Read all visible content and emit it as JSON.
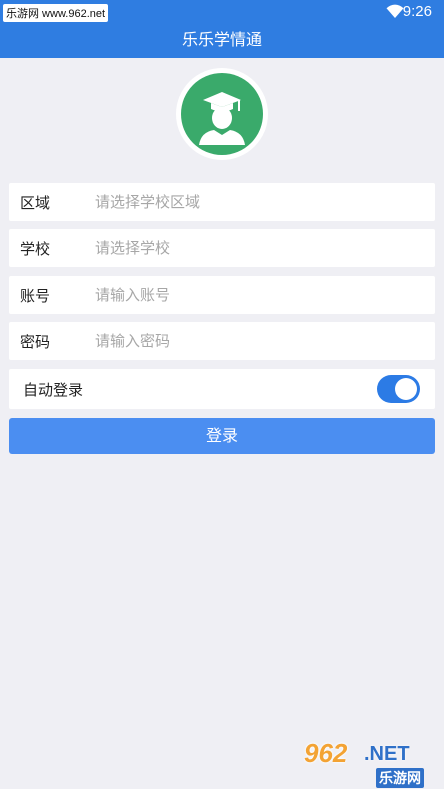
{
  "status_bar": {
    "site_label": "乐游网 www.962.net",
    "time": "9:26"
  },
  "app_bar": {
    "title": "乐乐学情通"
  },
  "form": {
    "region": {
      "label": "区域",
      "placeholder": "请选择学校区域"
    },
    "school": {
      "label": "学校",
      "placeholder": "请选择学校"
    },
    "account": {
      "label": "账号",
      "placeholder": "请输入账号"
    },
    "password": {
      "label": "密码",
      "placeholder": "请输入密码"
    },
    "auto_login": {
      "label": "自动登录",
      "enabled": true
    }
  },
  "login_button": {
    "label": "登录"
  },
  "watermark": {
    "top": "962",
    "net": ".NET",
    "cn": "乐游网"
  },
  "colors": {
    "primary": "#2f7de1",
    "button": "#4b8ef1",
    "avatar_bg": "#3aaa6b",
    "background": "#efeff4"
  },
  "icons": [
    "wifi-icon",
    "graduate-avatar-icon",
    "toggle-switch"
  ]
}
